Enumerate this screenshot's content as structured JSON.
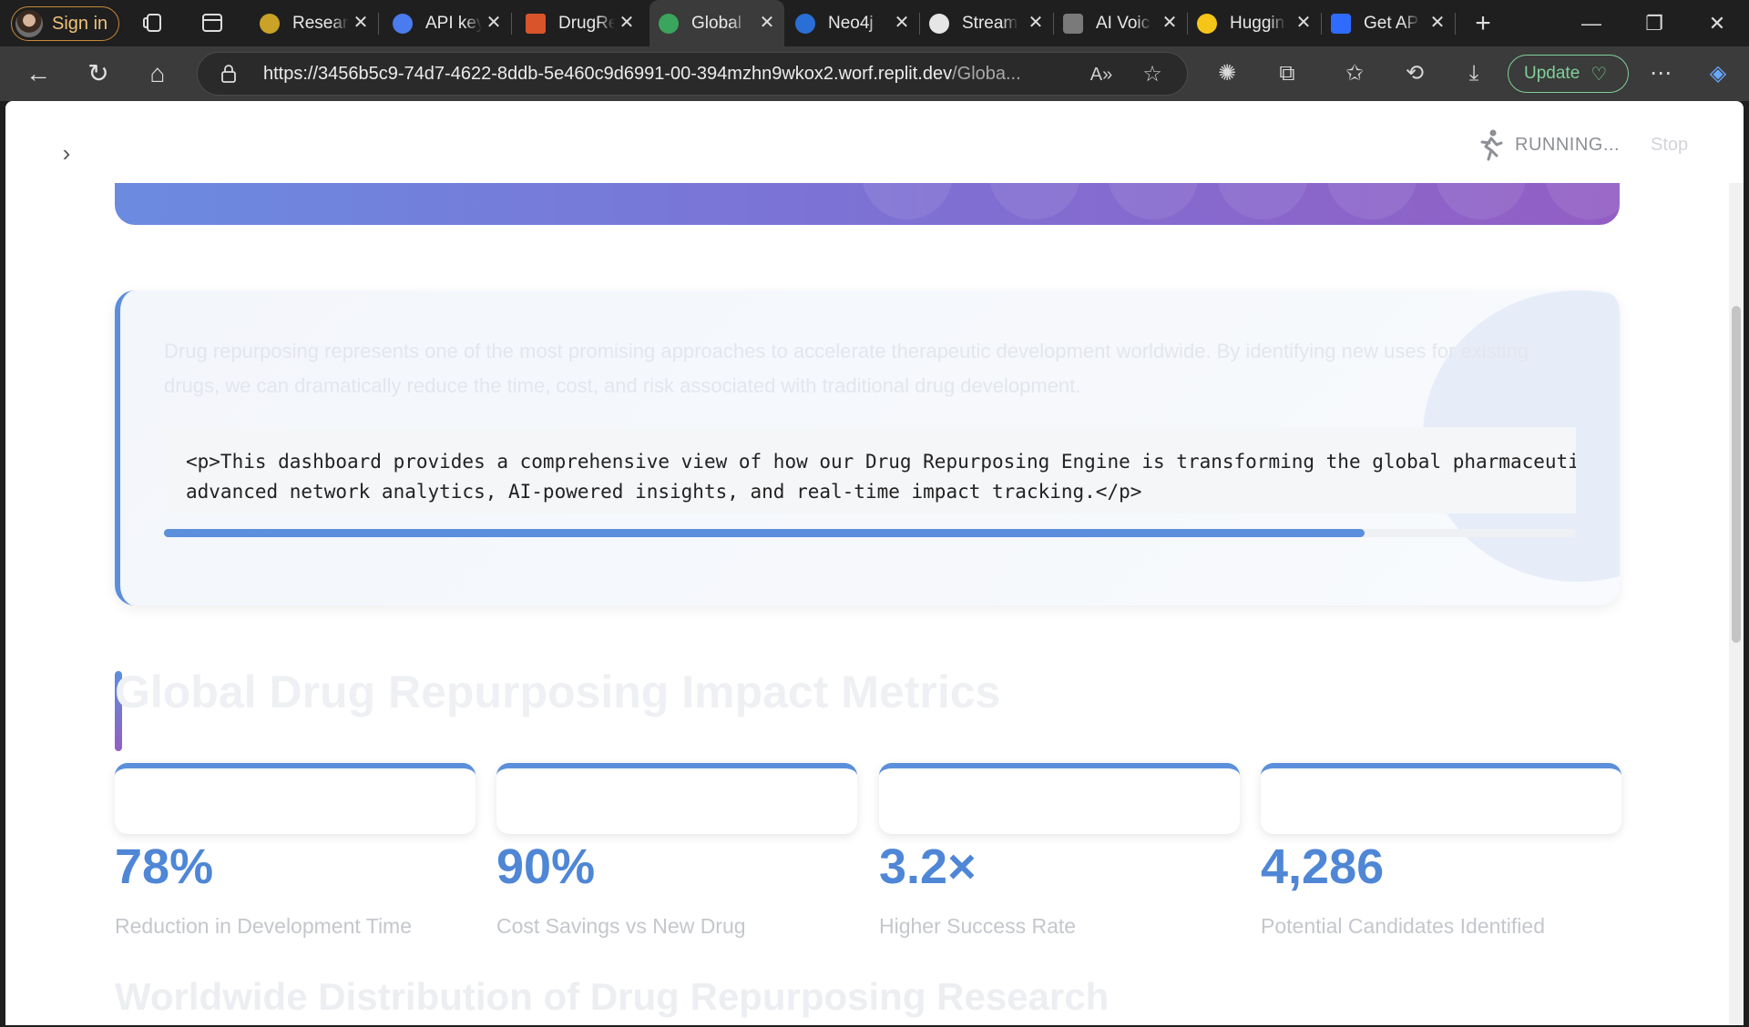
{
  "browser": {
    "signin_label": "Sign in",
    "tabs": [
      {
        "label": "Research",
        "color": "#c9a227"
      },
      {
        "label": "API keys",
        "color": "#4a7bef"
      },
      {
        "label": "DrugRe",
        "color": "#d9542b"
      },
      {
        "label": "Global",
        "color": "#3aa55d"
      },
      {
        "label": "Neo4j",
        "color": "#2a6fd6"
      },
      {
        "label": "Stream",
        "color": "#e6e6e6"
      },
      {
        "label": "AI Voic",
        "color": "#7a7a7a"
      },
      {
        "label": "Huggin",
        "color": "#f5c518"
      },
      {
        "label": "Get AP",
        "color": "#2f6bff"
      }
    ],
    "url_host": "https://3456b5c9-74d7-4622-8ddb-5e460c9d6991-00-394mzhn9wkox2.worf.replit.dev",
    "url_path": "/Globa...",
    "update_label": "Update"
  },
  "app": {
    "status_running": "RUNNING...",
    "stop_label": "Stop",
    "intro_text": "Drug repurposing represents one of the most promising approaches to accelerate therapeutic development worldwide. By identifying new uses for existing drugs, we can dramatically reduce the time, cost, and risk associated with traditional drug development.",
    "code_line1": "<p>This dashboard provides a comprehensive view of how our Drug Repurposing Engine is transforming the global pharmaceutical landscape through",
    "code_line2": "advanced network analytics, AI-powered insights, and real-time impact tracking.</p>",
    "progress_fraction": 0.85,
    "section_title": "Global Drug Repurposing Impact Metrics",
    "metrics": [
      {
        "value": "78%",
        "label": "Reduction in Development Time"
      },
      {
        "value": "90%",
        "label": "Cost Savings vs New Drug"
      },
      {
        "value": "3.2×",
        "label": "Higher Success Rate"
      },
      {
        "value": "4,286",
        "label": "Potential Candidates Identified"
      }
    ],
    "next_section_title": "Worldwide Distribution of Drug Repurposing Research"
  },
  "colors": {
    "accent": "#5b8fdc",
    "metric_value": "#4f86d6"
  }
}
